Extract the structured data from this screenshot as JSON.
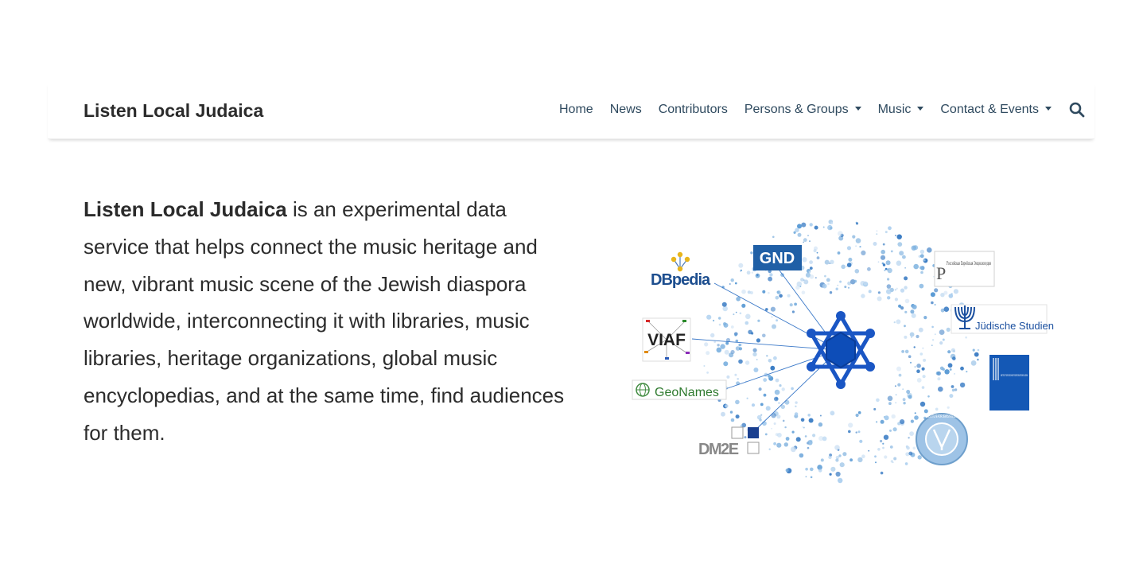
{
  "brand": "Listen Local Judaica",
  "nav": {
    "home": "Home",
    "news": "News",
    "contributors": "Contributors",
    "persons_groups": "Persons & Groups",
    "music": "Music",
    "contact_events": "Contact & Events",
    "search_icon": "search-icon"
  },
  "intro": {
    "strong": "Listen Local Judaica",
    "text": " is an experimental data service that helps connect the music heritage and new, vibrant music scene of the Jewish diaspora worldwide, interconnecting it with libraries, music libraries, heritage organizations, global music encyclopedias, and at the same time, find audiences for them."
  },
  "hero": {
    "logos": {
      "gnd": "GND",
      "dbpedia": "DBpedia",
      "viaf": "VIAF",
      "geonames": "GeoNames",
      "dm2e": "DM2E",
      "encyclopedia": "Российская Еврейская Энциклопедия",
      "judische_studien": "Jüdische Studien",
      "institut": "INSTITUT FÜR GESCHICHTE DER DEUTSCHEN JUDEN",
      "yivo": "YIVO INSTITUTE FOR JEWISH RESEARCH"
    },
    "colors": {
      "star": "#1a56c4",
      "dots": "#5b9bd5",
      "gnd_bg": "#1f5fa6"
    }
  }
}
